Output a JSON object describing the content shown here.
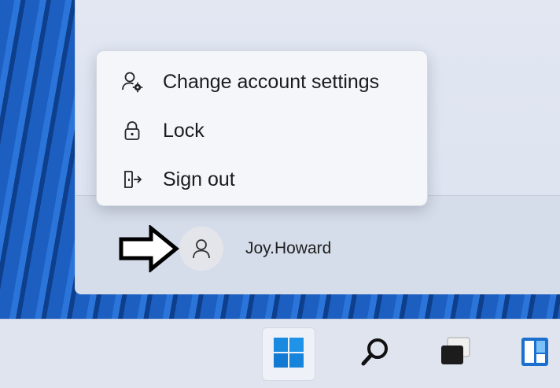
{
  "account_menu": {
    "items": [
      {
        "label": "Change account settings",
        "icon": "account-settings-icon"
      },
      {
        "label": "Lock",
        "icon": "lock-icon"
      },
      {
        "label": "Sign out",
        "icon": "sign-out-icon"
      }
    ]
  },
  "user": {
    "name": "Joy.Howard",
    "avatar_icon": "user-avatar-icon"
  },
  "taskbar": {
    "items": [
      {
        "icon": "windows-start-icon",
        "active": true
      },
      {
        "icon": "search-icon",
        "active": false
      },
      {
        "icon": "task-view-icon",
        "active": false
      },
      {
        "icon": "widgets-icon",
        "active": false
      }
    ]
  },
  "colors": {
    "accent": "#0b78d4",
    "menu_background": "#f4f6fa",
    "taskbar_background": "#dfe4ee"
  }
}
